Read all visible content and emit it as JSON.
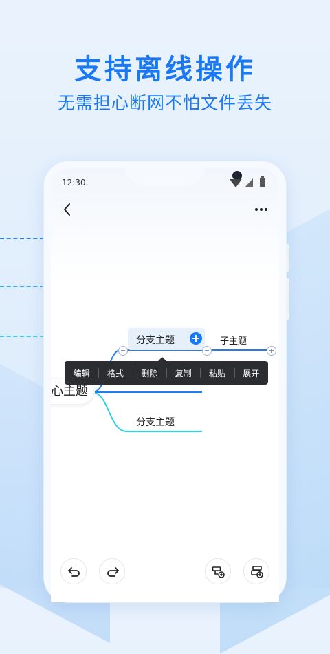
{
  "promo": {
    "headline": "支持离线操作",
    "subline": "无需担心断网不怕文件丢失"
  },
  "status_bar": {
    "time": "12:30"
  },
  "mindmap": {
    "central_topic": "心主题",
    "branch_topic_1": "分支主题",
    "child_topic": "子主题",
    "branch_topic_2": "分支主题"
  },
  "context_menu": {
    "items": [
      "编辑",
      "格式",
      "删除",
      "复制",
      "粘贴",
      "展开"
    ]
  },
  "colors": {
    "brand_blue": "#1a78f2",
    "branch_line_1": "#1f7ff0",
    "branch_line_2": "#2bd3e6",
    "menu_bg": "#2b2d31"
  },
  "icons": {
    "back": "back-arrow-icon",
    "more": "more-dots-icon",
    "undo": "undo-icon",
    "redo": "redo-icon",
    "add_child": "add-child-node-icon",
    "add_sibling": "add-sibling-node-icon"
  }
}
